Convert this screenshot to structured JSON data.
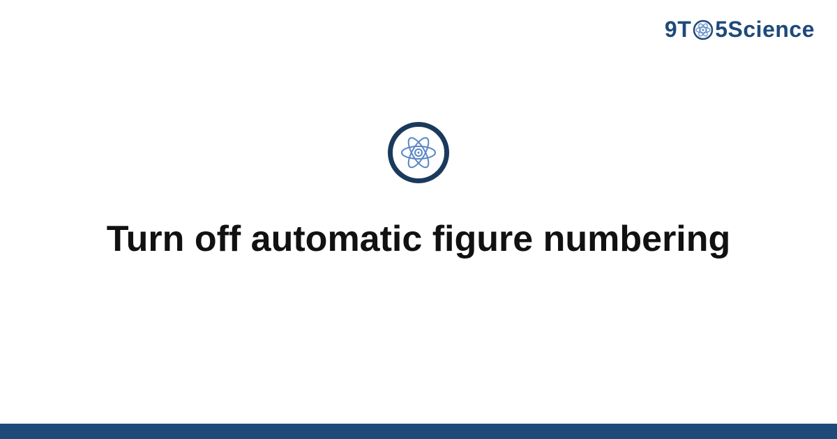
{
  "brand": {
    "prefix": "9T",
    "suffix": "5Science"
  },
  "title": "Turn off automatic figure numbering",
  "colors": {
    "accent": "#1e4a7a",
    "icon_inner": "#5a87c4",
    "text": "#111111"
  }
}
